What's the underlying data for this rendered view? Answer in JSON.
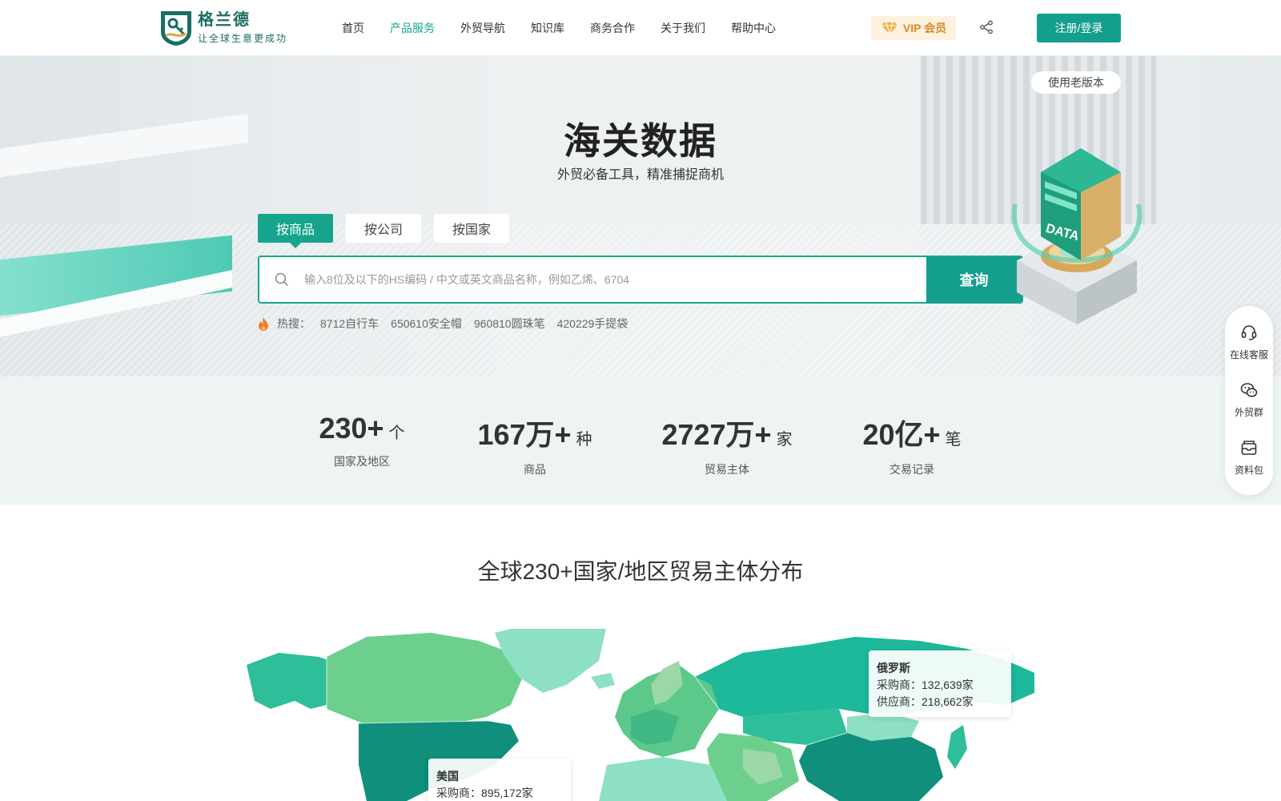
{
  "brand": {
    "name": "格兰德",
    "slogan": "让全球生意更成功"
  },
  "nav": {
    "items": [
      {
        "label": "首页",
        "active": false
      },
      {
        "label": "产品服务",
        "active": true
      },
      {
        "label": "外贸导航",
        "active": false
      },
      {
        "label": "知识库",
        "active": false
      },
      {
        "label": "商务合作",
        "active": false
      },
      {
        "label": "关于我们",
        "active": false
      },
      {
        "label": "帮助中心",
        "active": false
      }
    ],
    "vip_label": "VIP 会员",
    "login_label": "注册/登录"
  },
  "hero": {
    "old_version": "使用老版本",
    "title": "海关数据",
    "subtitle": "外贸必备工具，精准捕捉商机",
    "tabs": [
      {
        "label": "按商品",
        "active": true
      },
      {
        "label": "按公司",
        "active": false
      },
      {
        "label": "按国家",
        "active": false
      }
    ],
    "search": {
      "value": "",
      "placeholder": "输入8位及以下的HS编码 / 中文或英文商品名称，例如乙烯、6704",
      "button": "查询"
    },
    "hot": {
      "label": "热搜：",
      "keywords": [
        "8712自行车",
        "650610安全帽",
        "960810圆珠笔",
        "420229手提袋"
      ]
    },
    "illustration_text": "DATA"
  },
  "stats": [
    {
      "value": "230+",
      "unit": "个",
      "label": "国家及地区"
    },
    {
      "value": "167万+",
      "unit": "种",
      "label": "商品"
    },
    {
      "value": "2727万+",
      "unit": "家",
      "label": "贸易主体"
    },
    {
      "value": "20亿+",
      "unit": "笔",
      "label": "交易记录"
    }
  ],
  "sidebar": [
    {
      "label": "在线客服",
      "icon": "headset-icon"
    },
    {
      "label": "外贸群",
      "icon": "wechat-icon"
    },
    {
      "label": "资料包",
      "icon": "package-icon"
    }
  ],
  "world": {
    "title": "全球230+国家/地区贸易主体分布",
    "tooltips": {
      "russia": {
        "name": "俄罗斯",
        "buyers": "采购商：132,639家",
        "suppliers": "供应商：218,662家"
      },
      "usa": {
        "name": "美国",
        "buyers": "采购商：895,172家"
      }
    }
  },
  "colors": {
    "primary": "#139e8d",
    "accent": "#16a58c",
    "vip": "#d88a2a"
  }
}
